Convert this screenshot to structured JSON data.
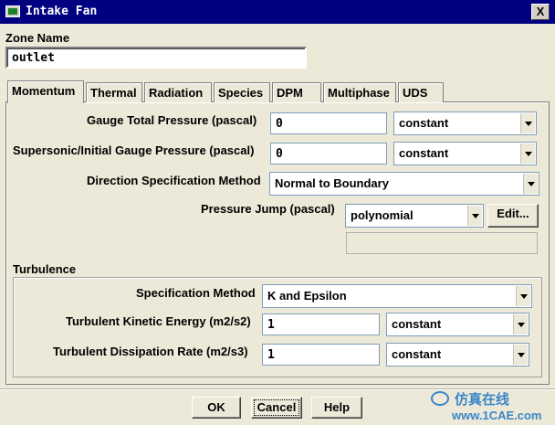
{
  "window": {
    "title": "Intake Fan",
    "close_label": "X"
  },
  "zone": {
    "label": "Zone Name",
    "value": "outlet"
  },
  "tabs": [
    {
      "label": "Momentum"
    },
    {
      "label": "Thermal"
    },
    {
      "label": "Radiation"
    },
    {
      "label": "Species"
    },
    {
      "label": "DPM"
    },
    {
      "label": "Multiphase"
    },
    {
      "label": "UDS"
    }
  ],
  "momentum": {
    "gauge_total_pressure": {
      "label": "Gauge Total Pressure (pascal)",
      "value": "0",
      "method": "constant"
    },
    "supersonic_pressure": {
      "label": "Supersonic/Initial Gauge Pressure (pascal)",
      "value": "0",
      "method": "constant"
    },
    "direction_method": {
      "label": "Direction Specification Method",
      "value": "Normal to Boundary"
    },
    "pressure_jump": {
      "label": "Pressure Jump (pascal)",
      "method": "polynomial",
      "edit_label": "Edit..."
    }
  },
  "turbulence": {
    "title": "Turbulence",
    "spec_method": {
      "label": "Specification Method",
      "value": "K and Epsilon"
    },
    "tke": {
      "label": "Turbulent Kinetic Energy (m2/s2)",
      "value": "1",
      "method": "constant"
    },
    "tdr": {
      "label": "Turbulent Dissipation Rate (m2/s3)",
      "value": "1",
      "method": "constant"
    }
  },
  "buttons": {
    "ok": "OK",
    "cancel": "Cancel",
    "help": "Help"
  },
  "watermark": {
    "text": "仿真在线",
    "url": "www.1CAE.com"
  },
  "colors": {
    "titlebar": "#000080",
    "dialog_bg": "#ece9d8",
    "field_border": "#7f9db9",
    "watermark": "#3a86c8"
  }
}
